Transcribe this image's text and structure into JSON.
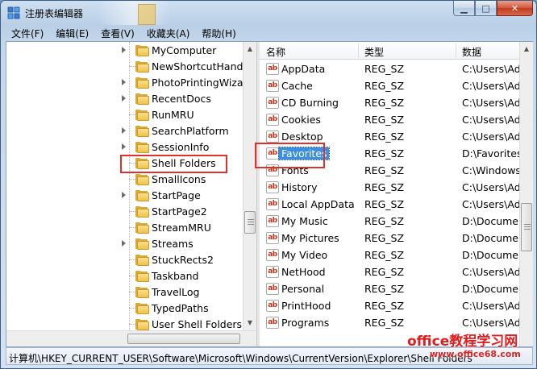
{
  "window": {
    "title": "注册表编辑器"
  },
  "caption_buttons": {
    "minimize": "▁",
    "maximize": "□",
    "close": "✕"
  },
  "menu": [
    {
      "label": "文件(F)"
    },
    {
      "label": "编辑(E)"
    },
    {
      "label": "查看(V)"
    },
    {
      "label": "收藏夹(A)"
    },
    {
      "label": "帮助(H)"
    }
  ],
  "tree": {
    "items": [
      {
        "label": "MyComputer",
        "expandable": true
      },
      {
        "label": "NewShortcutHandl",
        "expandable": false
      },
      {
        "label": "PhotoPrintingWiza",
        "expandable": true
      },
      {
        "label": "RecentDocs",
        "expandable": true
      },
      {
        "label": "RunMRU",
        "expandable": false
      },
      {
        "label": "SearchPlatform",
        "expandable": true
      },
      {
        "label": "SessionInfo",
        "expandable": true
      },
      {
        "label": "Shell Folders",
        "expandable": false,
        "highlighted": true
      },
      {
        "label": "SmallIcons",
        "expandable": false
      },
      {
        "label": "StartPage",
        "expandable": true
      },
      {
        "label": "StartPage2",
        "expandable": false
      },
      {
        "label": "StreamMRU",
        "expandable": false
      },
      {
        "label": "Streams",
        "expandable": true
      },
      {
        "label": "StuckRects2",
        "expandable": false
      },
      {
        "label": "Taskband",
        "expandable": false
      },
      {
        "label": "TravelLog",
        "expandable": false
      },
      {
        "label": "TypedPaths",
        "expandable": false
      },
      {
        "label": "User Shell Folders",
        "expandable": false
      }
    ]
  },
  "list": {
    "columns": {
      "name": "名称",
      "type": "类型",
      "data": "数据"
    },
    "value_icon": "ab",
    "rows": [
      {
        "name": "AppData",
        "type": "REG_SZ",
        "data": "C:\\Users\\Adr"
      },
      {
        "name": "Cache",
        "type": "REG_SZ",
        "data": "C:\\Users\\Adr"
      },
      {
        "name": "CD Burning",
        "type": "REG_SZ",
        "data": "C:\\Users\\Adr"
      },
      {
        "name": "Cookies",
        "type": "REG_SZ",
        "data": "C:\\Users\\Adr"
      },
      {
        "name": "Desktop",
        "type": "REG_SZ",
        "data": "C:\\Users\\Adr"
      },
      {
        "name": "Favorites",
        "type": "REG_SZ",
        "data": "D:\\Favorites",
        "selected": true
      },
      {
        "name": "Fonts",
        "type": "REG_SZ",
        "data": "C:\\Windows\\"
      },
      {
        "name": "History",
        "type": "REG_SZ",
        "data": "C:\\Users\\Adr"
      },
      {
        "name": "Local AppData",
        "type": "REG_SZ",
        "data": "C:\\Users\\Adr"
      },
      {
        "name": "My Music",
        "type": "REG_SZ",
        "data": "D:\\Documen"
      },
      {
        "name": "My Pictures",
        "type": "REG_SZ",
        "data": "D:\\Documen"
      },
      {
        "name": "My Video",
        "type": "REG_SZ",
        "data": "D:\\Documen"
      },
      {
        "name": "NetHood",
        "type": "REG_SZ",
        "data": "C:\\Users\\Adr"
      },
      {
        "name": "Personal",
        "type": "REG_SZ",
        "data": "D:\\Documen"
      },
      {
        "name": "PrintHood",
        "type": "REG_SZ",
        "data": "C:\\Users\\Adr"
      },
      {
        "name": "Programs",
        "type": "REG_SZ",
        "data": "C:\\Users\\Adr"
      }
    ]
  },
  "statusbar": {
    "path": "计算机\\HKEY_CURRENT_USER\\Software\\Microsoft\\Windows\\CurrentVersion\\Explorer\\Shell Folders"
  },
  "watermark": {
    "main": "office教程学习网",
    "url": "www.office68.com"
  },
  "colors": {
    "highlight_box": "#e0302a",
    "selection": "#3a8fe3",
    "watermark": "#e21d20"
  }
}
